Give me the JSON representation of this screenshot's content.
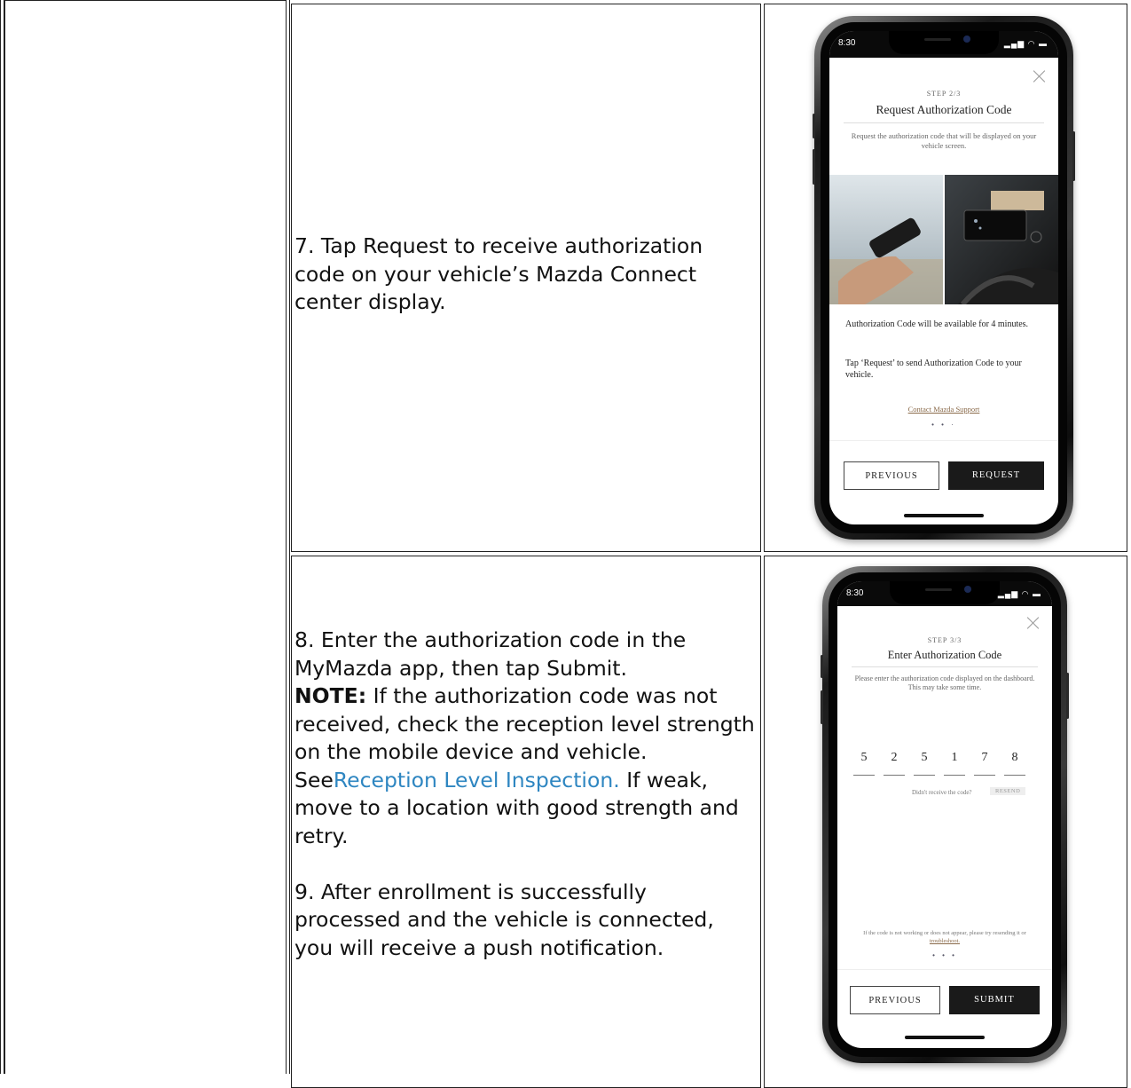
{
  "rows": [
    {
      "text_lines": [
        "7. Tap Request to receive authorization",
        "code on your vehicle’s Mazda Connect",
        "center display."
      ],
      "phone": {
        "time": "8:30",
        "step": "STEP 2/3",
        "title": "Request Authorization Code",
        "subtitle": "Request the authorization code that will be displayed on your vehicle screen.",
        "para1": "Authorization Code will be available for 4 minutes.",
        "para2": "Tap ‘Request’ to send Authorization Code to your vehicle.",
        "support_link": "Contact Mazda Support",
        "dots": "• • ·",
        "prev_label": "PREVIOUS",
        "primary_label": "REQUEST"
      }
    },
    {
      "line1": "8. Enter the authorization code in the",
      "line2": "MyMazda app, then tap Submit.",
      "note_label": "NOTE:",
      "note_line3": " If the authorization code was not",
      "line4": "received, check the reception level strength",
      "line5": "on the mobile device and vehicle.",
      "see_prefix": "See",
      "see_link": "Reception Level Inspection.",
      "see_suffix": " If weak,",
      "line7": "move to a location with good strength and",
      "line8": "retry.",
      "step9_lines": [
        "9. After enrollment is successfully",
        "processed and the vehicle is connected,",
        "you will receive a push notification."
      ],
      "phone": {
        "time": "8:30",
        "step": "STEP 3/3",
        "title": "Enter Authorization Code",
        "subtitle": "Please enter the authorization code displayed on the dashboard. This may take some time.",
        "code_digits": [
          "5",
          "2",
          "5",
          "1",
          "7",
          "8"
        ],
        "resend_question": "Didn't receive the code?",
        "resend_label": "RESEND",
        "help_text": "If the code is not working or does not appear, please try resending it or",
        "help_link": "troubleshoot.",
        "dots": "• • •",
        "prev_label": "PREVIOUS",
        "primary_label": "SUBMIT"
      }
    }
  ]
}
